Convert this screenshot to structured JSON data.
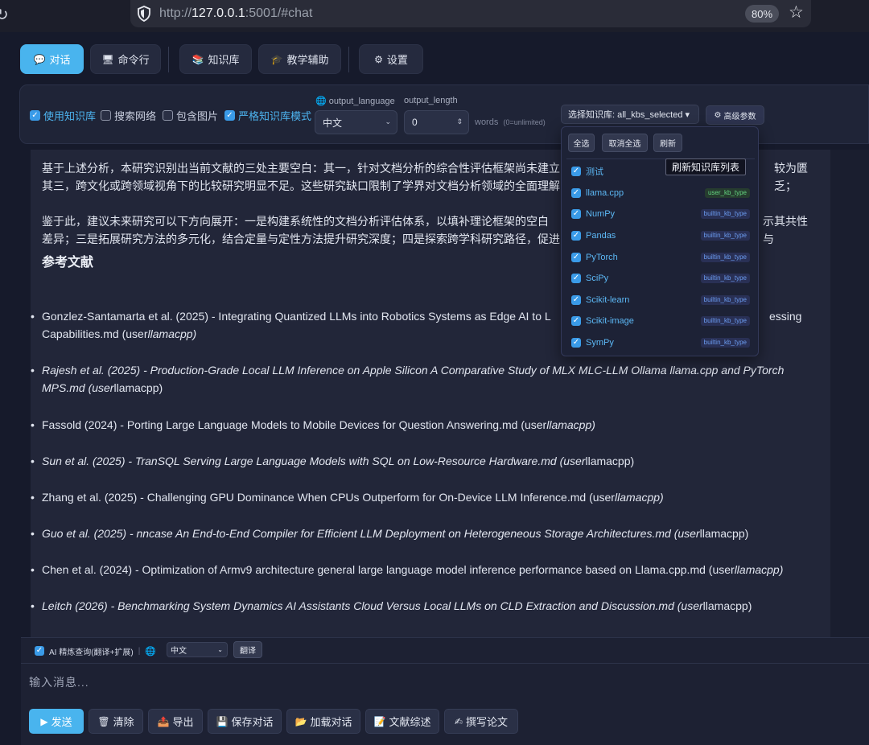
{
  "browser": {
    "url_prefix": "http://",
    "url_host": "127.0.0.1",
    "url_rest": ":5001/#chat",
    "zoom": "80%"
  },
  "tabs": [
    {
      "icon": "💬",
      "label": "对话",
      "active": true
    },
    {
      "icon": "🖥",
      "label": "命令行"
    },
    {
      "icon": "📚",
      "label": "知识库"
    },
    {
      "icon": "🎓",
      "label": "教学辅助"
    },
    {
      "icon": "⚙",
      "label": "设置"
    }
  ],
  "options": {
    "use_kb": "使用知识库",
    "search_web": "搜索网络",
    "include_images": "包含图片",
    "strict_kb": "严格知识库模式",
    "output_language_label": "output_language",
    "output_language_value": "中文",
    "output_length_label": "output_length",
    "output_length_value": "0",
    "words_hint": "words",
    "words_hint_small": "(0=unlimited)",
    "kb_select_label": "选择知识库: all_kbs_selected ▾",
    "advanced_label": "高级参数"
  },
  "kb_dropdown": {
    "select_all": "全选",
    "deselect_all": "取消全选",
    "refresh": "刷新",
    "refresh_tooltip": "刷新知识库列表",
    "items": [
      {
        "name": "测试",
        "type": ""
      },
      {
        "name": "llama.cpp",
        "type": "user_kb_type"
      },
      {
        "name": "NumPy",
        "type": "builtin_kb_type"
      },
      {
        "name": "Pandas",
        "type": "builtin_kb_type"
      },
      {
        "name": "PyTorch",
        "type": "builtin_kb_type"
      },
      {
        "name": "SciPy",
        "type": "builtin_kb_type"
      },
      {
        "name": "Scikit-learn",
        "type": "builtin_kb_type"
      },
      {
        "name": "Scikit-image",
        "type": "builtin_kb_type"
      },
      {
        "name": "SymPy",
        "type": "builtin_kb_type"
      }
    ]
  },
  "chat": {
    "para1_line1": "基于上述分析，本研究识别出当前文献的三处主要空白：其一，针对文档分析的综合性评估框架尚未建立",
    "para1_line1_end": "较为匮乏；",
    "para1_line2": "其三，跨文化或跨领域视角下的比较研究明显不足。这些研究缺口限制了学界对文档分析领域的全面理解",
    "para2_line1": "鉴于此，建议未来研究可以下方向展开：一是构建系统性的文档分析评估体系，以填补理论框架的空白",
    "para2_line1_end": "示其共性与",
    "para2_line2": "差异；三是拓展研究方法的多元化，结合定量与定性方法提升研究深度；四是探索跨学科研究路径，促进",
    "refs_heading": "参考文献",
    "refs": [
      {
        "line1": "Gonzlez-Santamarta et al. (2025) - Integrating Quantized LLMs into Robotics Systems as Edge AI to L",
        "line1_end": "essing",
        "line2_a": "Capabilities.md (user",
        "line2_b": "llamacpp)"
      },
      {
        "line1": "Rajesh et al. (2025) - Production-Grade Local LLM Inference on Apple Silicon A Comparative Study of MLX MLC-LLM Ollama llama.cpp and PyTorch",
        "line2_a": "MPS.md (user",
        "line2_b": "llamacpp)"
      },
      {
        "line1_a": "Fassold (2024) - Porting Large Language Models to Mobile Devices for Question Answering.md (user",
        "line1_b": "llamacpp)"
      },
      {
        "line1_a": "Sun et al. (2025) - TranSQL Serving Large Language Models with SQL on Low-Resource Hardware.md (user",
        "line1_b": "llamacpp)"
      },
      {
        "line1_a": "Zhang et al. (2025) - Challenging GPU Dominance When CPUs Outperform for On-Device LLM Inference.md (user",
        "line1_b": "llamacpp)"
      },
      {
        "line1_a": "Guo et al. (2025) - nncase An End-to-End Compiler for Efficient LLM Deployment on Heterogeneous Storage Architectures.md (user",
        "line1_b": "llamacpp)"
      },
      {
        "line1_a": "Chen et al. (2024) - Optimization of Armv9 architecture general large language model inference performance based on Llama.cpp.md (user",
        "line1_b": "llamacpp)"
      },
      {
        "line1_a": "Leitch (2026) - Benchmarking System Dynamics AI Assistants Cloud Versus Local LLMs on CLD Extraction and Discussion.md (user",
        "line1_b": "llamacpp)"
      }
    ]
  },
  "composer": {
    "refine_label": "AI 精炼查询(翻译+扩展)",
    "refine_sep": "|",
    "lang_value": "中文",
    "translate_label": "翻译",
    "placeholder": "输入消息..."
  },
  "actions": [
    {
      "icon": "▶",
      "label": "发送"
    },
    {
      "icon": "🗑",
      "label": "清除"
    },
    {
      "icon": "📤",
      "label": "导出"
    },
    {
      "icon": "💾",
      "label": "保存对话"
    },
    {
      "icon": "📂",
      "label": "加载对话"
    },
    {
      "icon": "📝",
      "label": "文献综述"
    },
    {
      "icon": "✍",
      "label": "撰写论文"
    }
  ]
}
